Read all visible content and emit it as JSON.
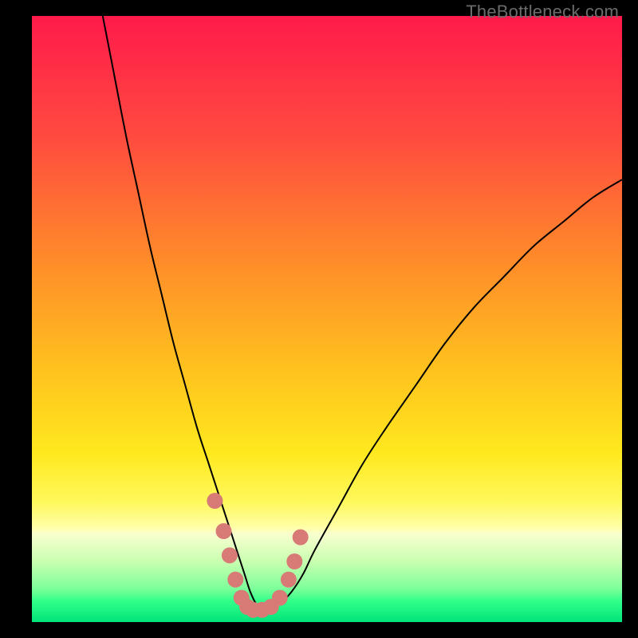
{
  "watermark": "TheBottleneck.com",
  "chart_data": {
    "type": "line",
    "title": "",
    "xlabel": "",
    "ylabel": "",
    "xlim": [
      0,
      100
    ],
    "ylim": [
      0,
      100
    ],
    "grid": false,
    "legend": false,
    "gradient_stops": [
      {
        "offset": 0.0,
        "color": "#ff1a4b"
      },
      {
        "offset": 0.2,
        "color": "#ff4b3f"
      },
      {
        "offset": 0.4,
        "color": "#ff8a2a"
      },
      {
        "offset": 0.58,
        "color": "#ffc11e"
      },
      {
        "offset": 0.72,
        "color": "#ffe81e"
      },
      {
        "offset": 0.8,
        "color": "#fff85a"
      },
      {
        "offset": 0.845,
        "color": "#ffffaa"
      },
      {
        "offset": 0.855,
        "color": "#f8ffd0"
      },
      {
        "offset": 0.9,
        "color": "#c9ffb0"
      },
      {
        "offset": 0.945,
        "color": "#7dff9a"
      },
      {
        "offset": 0.965,
        "color": "#32ff8a"
      },
      {
        "offset": 1.0,
        "color": "#00e47a"
      }
    ],
    "series": [
      {
        "name": "bottleneck-curve",
        "color": "#000000",
        "x": [
          12,
          14,
          16,
          18,
          20,
          22,
          24,
          26,
          28,
          30,
          32,
          34,
          35,
          36,
          37,
          38,
          39,
          40,
          42,
          44,
          46,
          48,
          52,
          56,
          60,
          65,
          70,
          75,
          80,
          85,
          90,
          95,
          100
        ],
        "y": [
          100,
          90,
          80,
          71,
          62,
          54,
          46,
          39,
          32,
          26,
          20,
          14,
          11,
          8,
          5,
          3,
          2,
          2,
          3,
          5,
          8,
          12,
          19,
          26,
          32,
          39,
          46,
          52,
          57,
          62,
          66,
          70,
          73
        ]
      },
      {
        "name": "highlight-markers",
        "type": "scatter",
        "color": "#d87a76",
        "x": [
          31,
          32.5,
          33.5,
          34.5,
          35.5,
          36.5,
          37.5,
          39,
          40.5,
          42,
          43.5,
          44.5,
          45.5
        ],
        "y": [
          20,
          15,
          11,
          7,
          4,
          2.5,
          2,
          2,
          2.5,
          4,
          7,
          10,
          14
        ]
      }
    ]
  }
}
